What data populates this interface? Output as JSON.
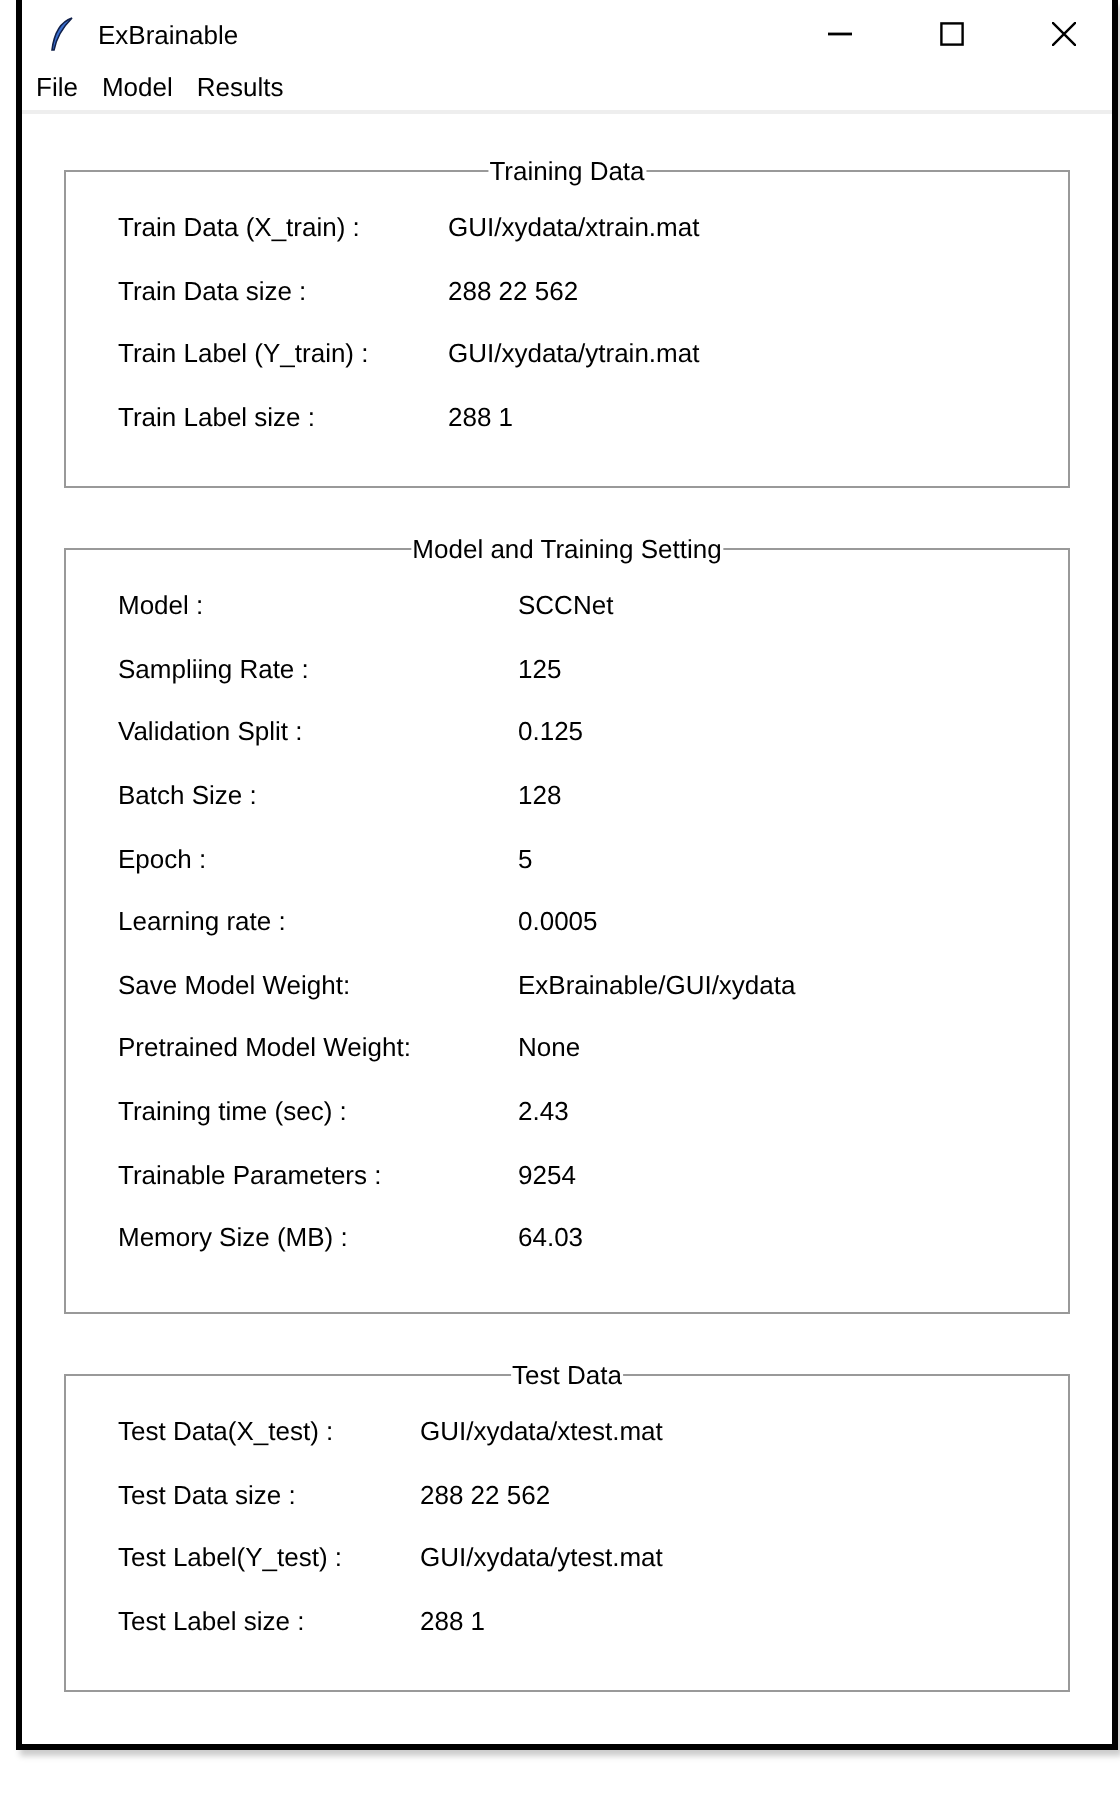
{
  "window": {
    "title": "ExBrainable"
  },
  "menu": [
    "File",
    "Model",
    "Results"
  ],
  "groups": [
    {
      "title": "Training Data",
      "rows": [
        {
          "label": "Train Data (X_train) :",
          "value": "GUI/xydata/xtrain.mat"
        },
        {
          "label": "Train Data size :",
          "value": "288 22 562"
        },
        {
          "label": "Train Label (Y_train) :",
          "value": "GUI/xydata/ytrain.mat"
        },
        {
          "label": "Train Label size :",
          "value": "288 1"
        }
      ]
    },
    {
      "title": "Model and Training Setting",
      "rows": [
        {
          "label": "Model :",
          "value": "SCCNet"
        },
        {
          "label": "Sampliing Rate :",
          "value": "125"
        },
        {
          "label": "Validation Split :",
          "value": "0.125"
        },
        {
          "label": "Batch Size :",
          "value": "128"
        },
        {
          "label": "Epoch :",
          "value": "5"
        },
        {
          "label": "Learning rate :",
          "value": "0.0005"
        },
        {
          "label": "Save Model Weight:",
          "value": "ExBrainable/GUI/xydata"
        },
        {
          "label": "Pretrained Model Weight:",
          "value": "None"
        },
        {
          "label": "Training time (sec) :",
          "value": "2.43"
        },
        {
          "label": "Trainable Parameters :",
          "value": "9254"
        },
        {
          "label": "Memory Size (MB) :",
          "value": "64.03"
        }
      ]
    },
    {
      "title": "Test Data",
      "rows": [
        {
          "label": "Test Data(X_test) :",
          "value": "GUI/xydata/xtest.mat"
        },
        {
          "label": "Test Data size :",
          "value": "288 22 562"
        },
        {
          "label": "Test Label(Y_test) :",
          "value": "GUI/xydata/ytest.mat"
        },
        {
          "label": "Test Label size :",
          "value": "288 1"
        }
      ]
    }
  ]
}
